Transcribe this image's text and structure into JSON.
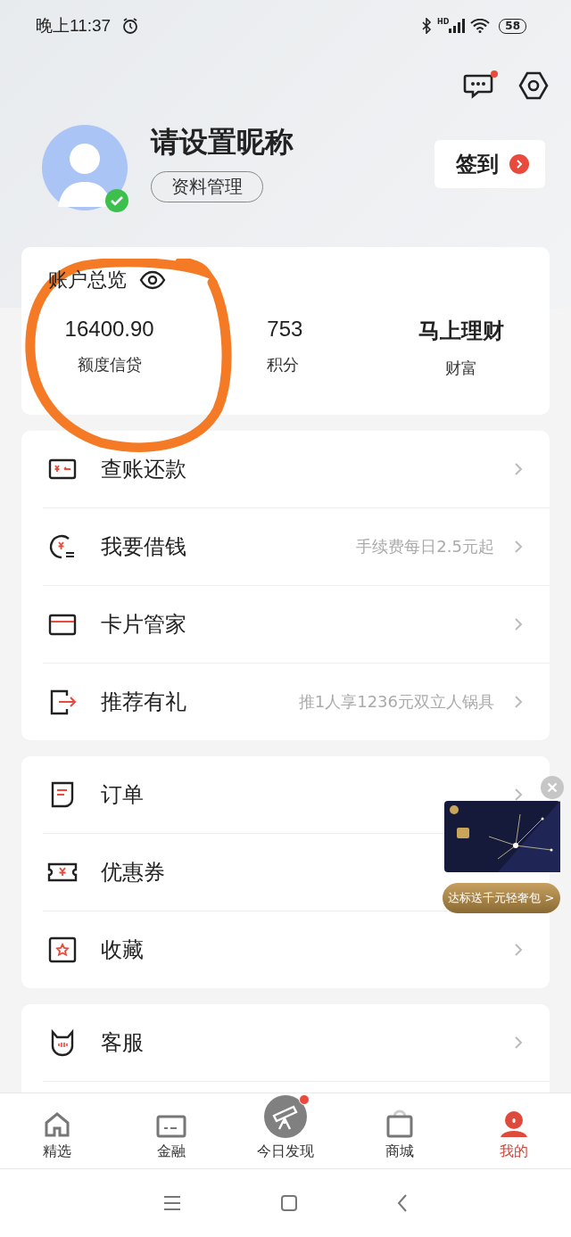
{
  "status_bar": {
    "time": "晚上11:37",
    "battery": "58",
    "network": "HD"
  },
  "profile": {
    "nickname": "请设置昵称",
    "manage_button": "资料管理",
    "verified": true,
    "checkin_button": "签到",
    "message_unread": true
  },
  "account": {
    "title": "账户总览",
    "stats": [
      {
        "value": "16400.90",
        "label": "额度信贷"
      },
      {
        "value": "753",
        "label": "积分"
      },
      {
        "value": "马上理财",
        "label": "财富"
      }
    ]
  },
  "menu_groups": [
    [
      {
        "label": "查账还款"
      },
      {
        "label": "我要借钱",
        "hint": "手续费每日2.5元起"
      },
      {
        "label": "卡片管家"
      },
      {
        "label": "推荐有礼",
        "hint": "推1人享1236元双立人锅具"
      }
    ],
    [
      {
        "label": "订单"
      },
      {
        "label": "优惠券",
        "chevron": false
      },
      {
        "label": "收藏"
      }
    ],
    [
      {
        "label": "客服"
      }
    ]
  ],
  "floating_ad": {
    "button": "达标送千元轻奢包 >"
  },
  "tabs": [
    {
      "label": "精选",
      "selected": false,
      "badge": false
    },
    {
      "label": "金融",
      "selected": false,
      "badge": false
    },
    {
      "label": "今日发现",
      "selected": false,
      "badge": true
    },
    {
      "label": "商城",
      "selected": false,
      "badge": false
    },
    {
      "label": "我的",
      "selected": true,
      "badge": false
    }
  ]
}
